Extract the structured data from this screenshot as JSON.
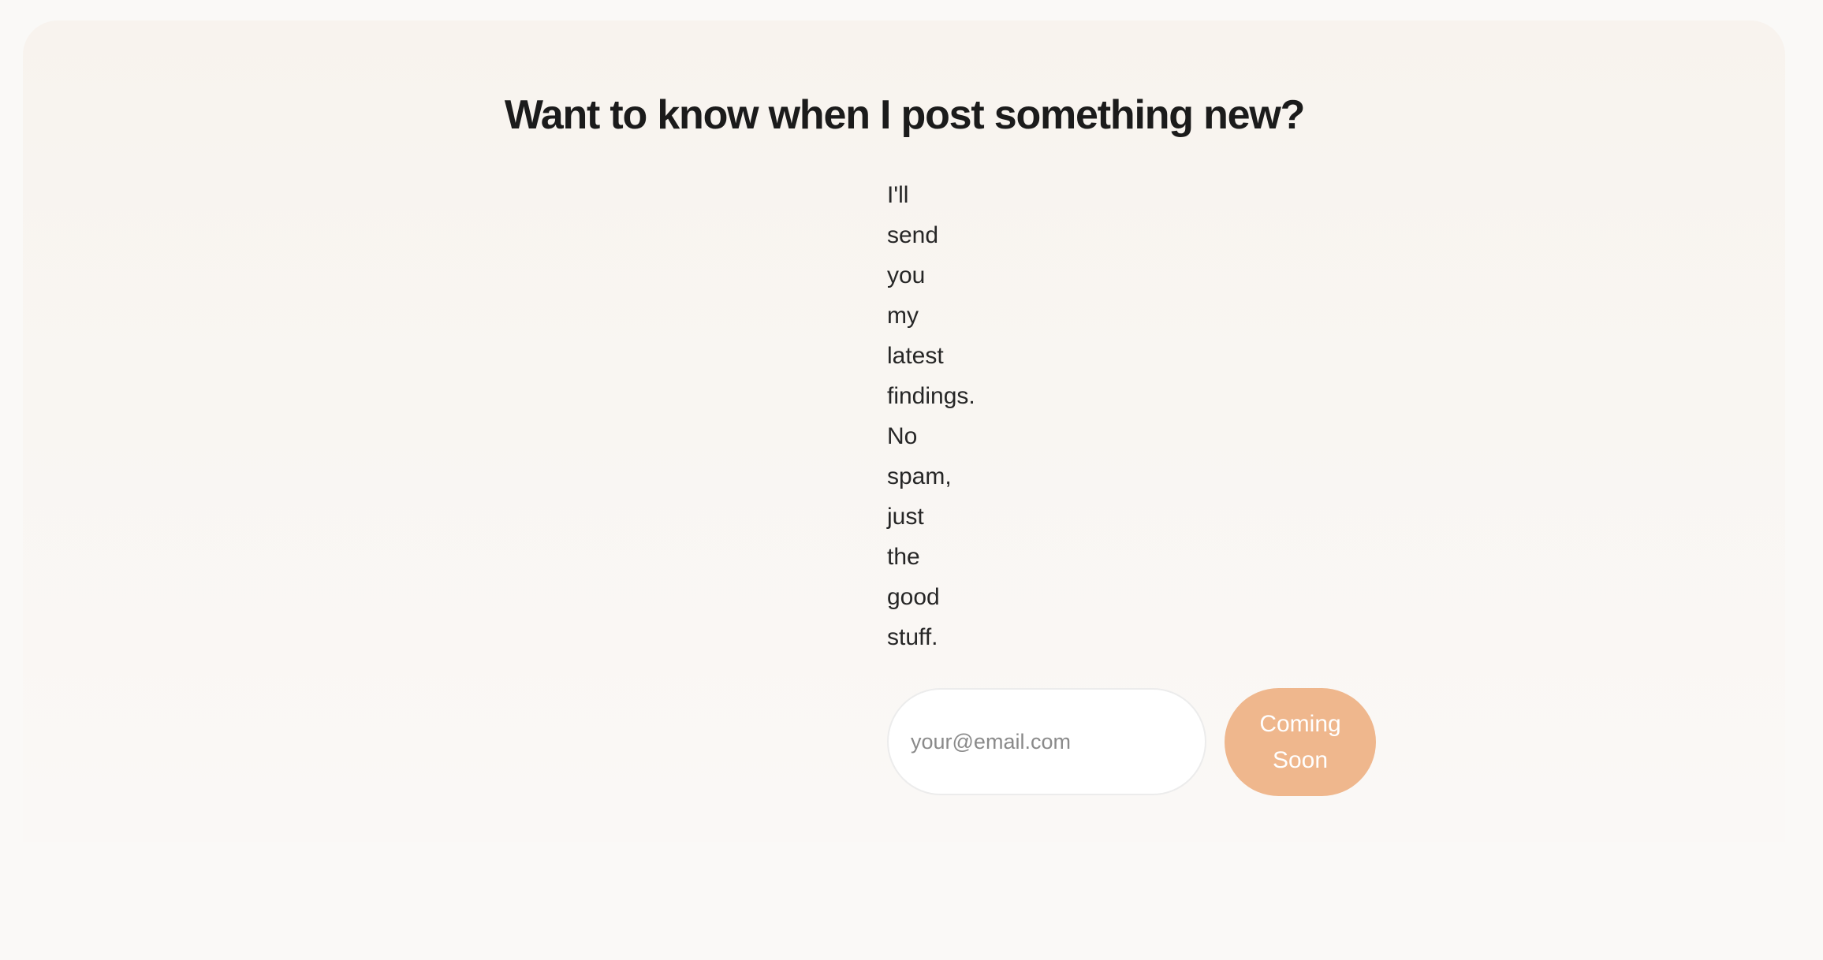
{
  "newsletter": {
    "headline": "Want to know when I post something new?",
    "intro_words": [
      "I'll",
      "send",
      "you",
      "my",
      "latest",
      "findings.",
      "No",
      "spam,",
      "just",
      "the",
      "good",
      "stuff."
    ],
    "email_placeholder": "your@email.com",
    "email_value": "",
    "button_label": "Coming Soon"
  },
  "colors": {
    "page_background": "#faf9f7",
    "card_background": "#f8f3ee",
    "button_background": "#efb78d",
    "button_text": "#ffffff",
    "text": "#1c1c1c"
  }
}
